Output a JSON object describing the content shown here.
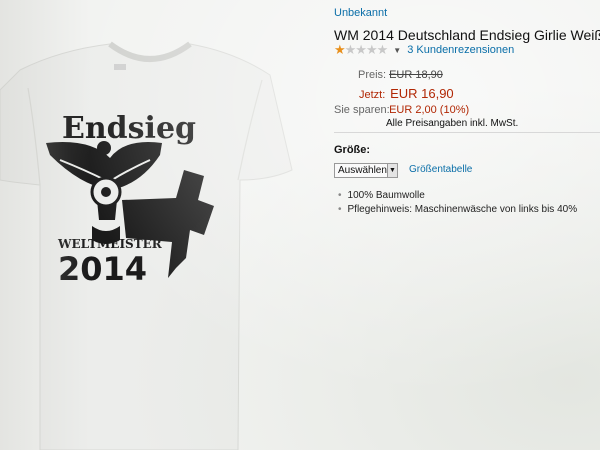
{
  "product": {
    "brand": "Unbekannt",
    "title": "WM 2014 Deutschland Endsieg Girlie Weiß",
    "rating_stars": 1,
    "rating_max": 5,
    "reviews": "3 Kundenrezensionen",
    "shirt_text": {
      "top": "Endsieg",
      "middle": "WELTMEISTER",
      "bottom": "2014"
    }
  },
  "prices": {
    "list_label": "Preis:",
    "list_price": "EUR 18,90",
    "now_label": "Jetzt:",
    "now_price": "EUR 16,90",
    "save_label": "Sie sparen:",
    "save_amount": "EUR 2,00 (10%)",
    "vat_note": "Alle Preisangaben inkl. MwSt."
  },
  "size": {
    "label": "Größe:",
    "selected": "Auswählen",
    "chart_link": "Größentabelle"
  },
  "features": [
    "100% Baumwolle",
    "Pflegehinweis: Maschinenwäsche von links bis 40%"
  ],
  "colors": {
    "link": "#0a6ea8",
    "price": "#b12704",
    "star": "#e8901c"
  }
}
